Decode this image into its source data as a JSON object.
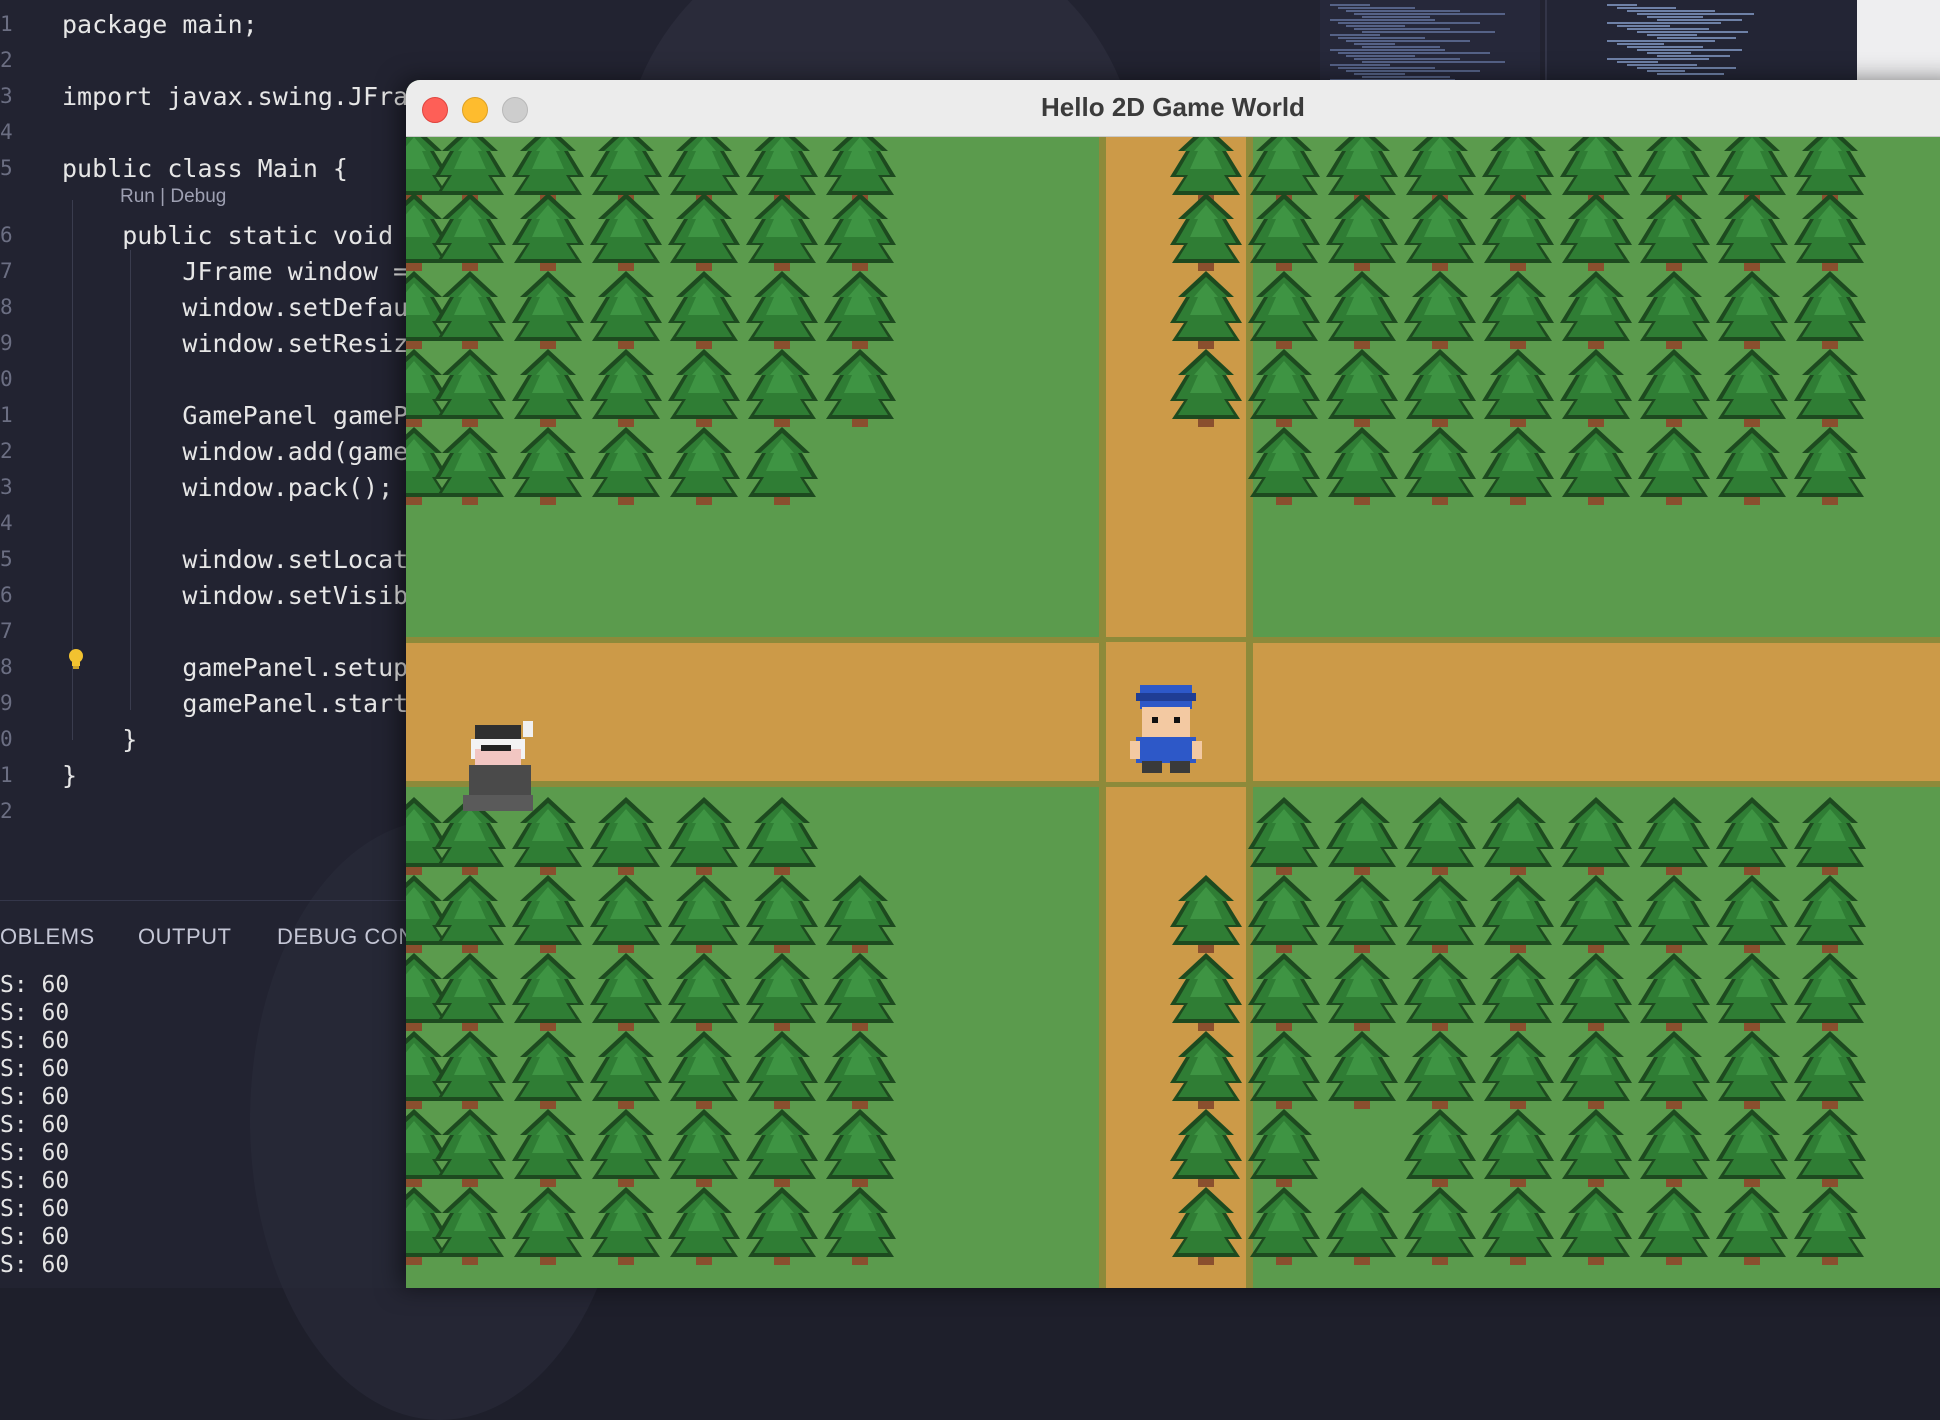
{
  "editor": {
    "lines": [
      {
        "n": "1",
        "code": "package main;"
      },
      {
        "n": "2",
        "code": ""
      },
      {
        "n": "3",
        "code": "import javax.swing.JFram"
      },
      {
        "n": "4",
        "code": ""
      },
      {
        "n": "5",
        "code": "public class Main {"
      },
      {
        "n": "6",
        "code": "    public static void m"
      },
      {
        "n": "7",
        "code": "        JFrame window = "
      },
      {
        "n": "8",
        "code": "        window.setDefaul"
      },
      {
        "n": "9",
        "code": "        window.setResiza"
      },
      {
        "n": "0",
        "code": ""
      },
      {
        "n": "1",
        "code": "        GamePanel gamePa"
      },
      {
        "n": "2",
        "code": "        window.add(gameP"
      },
      {
        "n": "3",
        "code": "        window.pack(); /"
      },
      {
        "n": "4",
        "code": ""
      },
      {
        "n": "5",
        "code": "        window.setLocati"
      },
      {
        "n": "6",
        "code": "        window.setVisibl"
      },
      {
        "n": "7",
        "code": ""
      },
      {
        "n": "8",
        "code": "        gamePanel.setupG"
      },
      {
        "n": "9",
        "code": "        gamePanel.startG"
      },
      {
        "n": "0",
        "code": "    }"
      },
      {
        "n": "1",
        "code": "}"
      },
      {
        "n": "2",
        "code": ""
      }
    ],
    "codelens": "Run | Debug"
  },
  "panel": {
    "tabs": [
      "OBLEMS",
      "OUTPUT",
      "DEBUG CON"
    ],
    "output": [
      "S: 60",
      "S: 60",
      "S: 60",
      "S: 60",
      "S: 60",
      "S: 60",
      "S: 60",
      "S: 60",
      "S: 60",
      "S: 60",
      "S: 60"
    ]
  },
  "window": {
    "title": "Hello 2D Game World",
    "colors": {
      "close": "#fe5f57",
      "minimize": "#febc2e",
      "zoom": "#cdcdcd",
      "grass": "#5b9b4d",
      "path": "#cc9a48",
      "tree": "#2e7d32"
    }
  }
}
